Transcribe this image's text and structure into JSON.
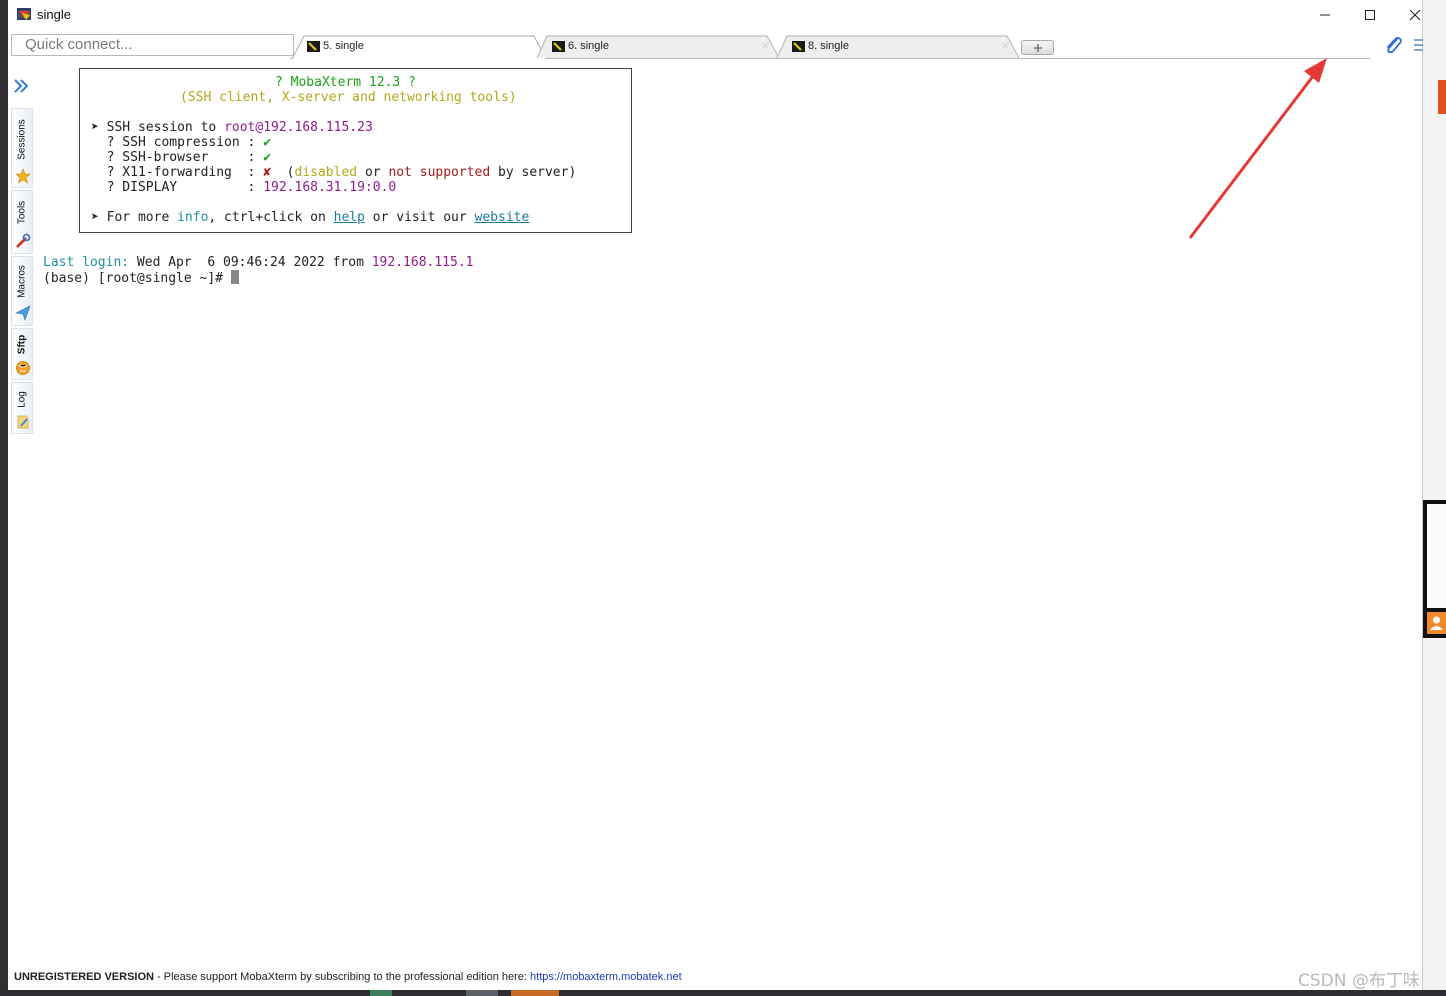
{
  "window": {
    "title": "single",
    "controls": [
      "minimize-icon",
      "maximize-icon",
      "close-icon"
    ]
  },
  "toolbar": {
    "quick_connect_placeholder": "Quick connect...",
    "tabs": [
      {
        "label": "5. single",
        "active": true
      },
      {
        "label": "6. single",
        "active": false
      },
      {
        "label": "8. single",
        "active": false
      }
    ],
    "close_glyph": "×"
  },
  "sidebar": {
    "items": [
      {
        "label": "Sessions",
        "icon": "star-icon"
      },
      {
        "label": "Tools",
        "icon": "tools-icon"
      },
      {
        "label": "Macros",
        "icon": "paper-plane-icon"
      },
      {
        "label": "Sftp",
        "icon": "sftp-globe-icon"
      },
      {
        "label": "Log",
        "icon": "log-icon"
      }
    ]
  },
  "terminal": {
    "banner": {
      "title": "? MobaXterm 12.3 ?",
      "subtitle": "(SSH client, X-server and networking tools)",
      "session_prefix": "➤ SSH session to ",
      "session_user": "root",
      "session_host": "@192.168.115.23",
      "features": [
        {
          "label": "  ? SSH compression : ",
          "value": "✔"
        },
        {
          "label": "  ? SSH-browser     : ",
          "value": "✔"
        },
        {
          "label": "  ? X11-forwarding  : ",
          "value": "✘"
        },
        {
          "label": "  ? DISPLAY         : ",
          "value": "192.168.31.19:0.0"
        }
      ],
      "x11_note_open": "  (",
      "x11_note_disabled": "disabled",
      "x11_note_or": " or ",
      "x11_note_not": "not supported",
      "x11_note_rest": " by server)",
      "info_prefix": "➤ For more ",
      "info_word": "info",
      "info_mid": ", ctrl+click on ",
      "help_link": "help",
      "info_visit": " or visit our ",
      "website_link": "website"
    },
    "last_login_label": "Last login:",
    "last_login_value": " Wed Apr  6 09:46:24 2022 from ",
    "last_login_ip": "192.168.115.1",
    "prompt": "(base) [root@single ~]# "
  },
  "status": {
    "unregistered": "UNREGISTERED VERSION",
    "message": "  -  Please support MobaXterm by subscribing to the professional edition here:  ",
    "url": "https://mobaxterm.mobatek.net"
  },
  "watermark": "CSDN @布丁味",
  "colors": {
    "accent_green": "#1aa31a",
    "banner_yellow": "#b2a81a",
    "ip_purple": "#8d1c8d",
    "cyan": "#1f8fa0",
    "annotation_red": "#e53935"
  }
}
